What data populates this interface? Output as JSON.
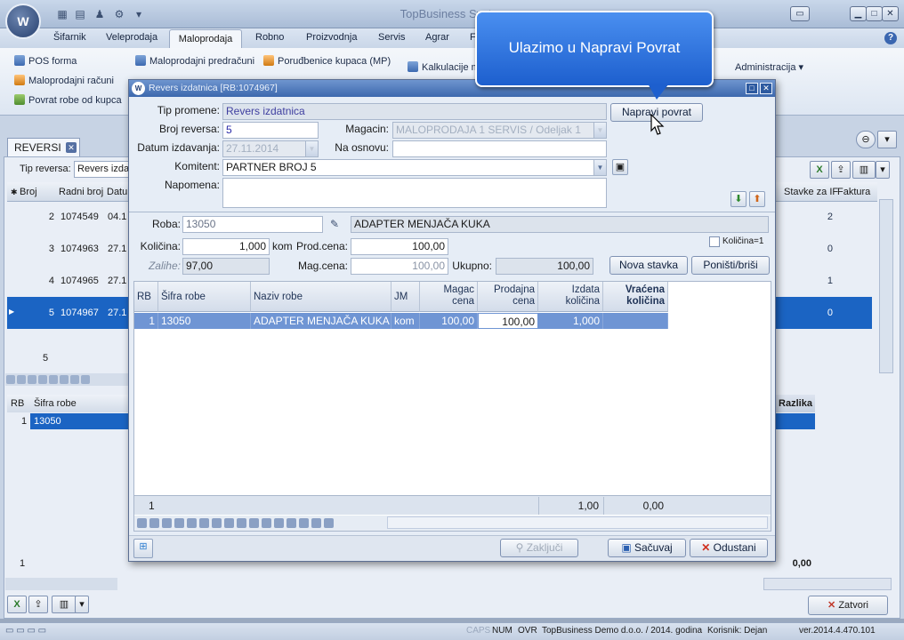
{
  "app": {
    "title": "TopBusiness System",
    "logo_text": "W",
    "help": "?"
  },
  "menu": [
    "Šifarnik",
    "Veleprodaja",
    "Maloprodaja",
    "Robno",
    "Proizvodnja",
    "Servis",
    "Agrar",
    "F"
  ],
  "ribbon": {
    "col1": [
      "POS forma",
      "Maloprodajni računi",
      "Povrat robe od kupca"
    ],
    "col2": [
      "Maloprodajni predračuni",
      "Poruđbenice kupaca (MP)"
    ],
    "kalkulacije": "Kalkulacije m",
    "administracija": "Administracija"
  },
  "callout": {
    "text": "Ulazimo u Napravi Povrat"
  },
  "background": {
    "tab_label": "REVERSI",
    "filter_label": "Tip reversa:",
    "filter_value": "Revers izda",
    "columns": [
      "Broj",
      "Radni broj",
      "Datu"
    ],
    "right_columns": [
      "Stavke za IF",
      "Faktura"
    ],
    "rows": [
      {
        "broj": "2",
        "radni": "1074549",
        "datum": "04.1",
        "stavke": "2"
      },
      {
        "broj": "3",
        "radni": "1074963",
        "datum": "27.1",
        "stavke": "0"
      },
      {
        "broj": "4",
        "radni": "1074965",
        "datum": "27.1",
        "stavke": "1"
      },
      {
        "broj": "5",
        "radni": "1074967",
        "datum": "27.1",
        "stavke": "0"
      }
    ],
    "count": "5",
    "detail_columns": [
      "RB",
      "Šifra robe"
    ],
    "detail_row": {
      "rb": "1",
      "sifra": "13050"
    },
    "razlika": "Razlika",
    "total_left": "1",
    "total_right": "0,00",
    "zatvori": "Zatvori"
  },
  "status": {
    "caps": "CAPS",
    "num": "NUM",
    "ovr": "OVR",
    "company": "TopBusiness Demo d.o.o. / 2014. godina",
    "user": "Korisnik: Dejan",
    "version": "ver.2014.4.470.101"
  },
  "dialog": {
    "title": "Revers izdatnica [RB:1074967]",
    "tip_promene_label": "Tip promene:",
    "tip_promene_value": "Revers izdatnica",
    "napravi_povrat": "Napravi povrat",
    "broj_reversa_label": "Broj reversa:",
    "broj_reversa_value": "5",
    "magacin_label": "Magacin:",
    "magacin_value": "MALOPRODAJA 1 SERVIS / Odeljak 1",
    "datum_label": "Datum izdavanja:",
    "datum_value": "27.11.2014",
    "na_osnovu_label": "Na osnovu:",
    "na_osnovu_value": "",
    "komitent_label": "Komitent:",
    "komitent_value": "PARTNER BROJ   5",
    "napomena_label": "Napomena:",
    "napomena_value": "",
    "roba_label": "Roba:",
    "roba_code": "13050",
    "roba_name": "ADAPTER MENJAČA KUKA",
    "kolicina_label": "Količina:",
    "kolicina_value": "1,000",
    "kolicina_unit": "kom",
    "prod_cena_label": "Prod.cena:",
    "prod_cena_value": "100,00",
    "kolicina1_label": "Količina=1",
    "zalihe_label": "Zalihe:",
    "zalihe_value": "97,00",
    "mag_cena_label": "Mag.cena:",
    "mag_cena_value": "100,00",
    "ukupno_label": "Ukupno:",
    "ukupno_value": "100,00",
    "nova_stavka": "Nova stavka",
    "ponisti": "Poništi/briši",
    "grid": {
      "headers": [
        "RB",
        "Šifra robe",
        "Naziv robe",
        "JM",
        "Magac cena",
        "Prodajna cena",
        "Izdata količina",
        "Vraćena količina"
      ],
      "rows": [
        {
          "rb": "1",
          "sifra": "13050",
          "naziv": "ADAPTER MENJAČA KUKA",
          "jm": "kom",
          "magac": "100,00",
          "prodajna": "100,00",
          "izdata": "1,000",
          "vracena": ""
        }
      ],
      "footer_count": "1",
      "footer_izdata": "1,00",
      "footer_vracena": "0,00"
    },
    "zakljuci": "Zaključi",
    "sacuvaj": "Sačuvaj",
    "odustani": "Odustani"
  }
}
